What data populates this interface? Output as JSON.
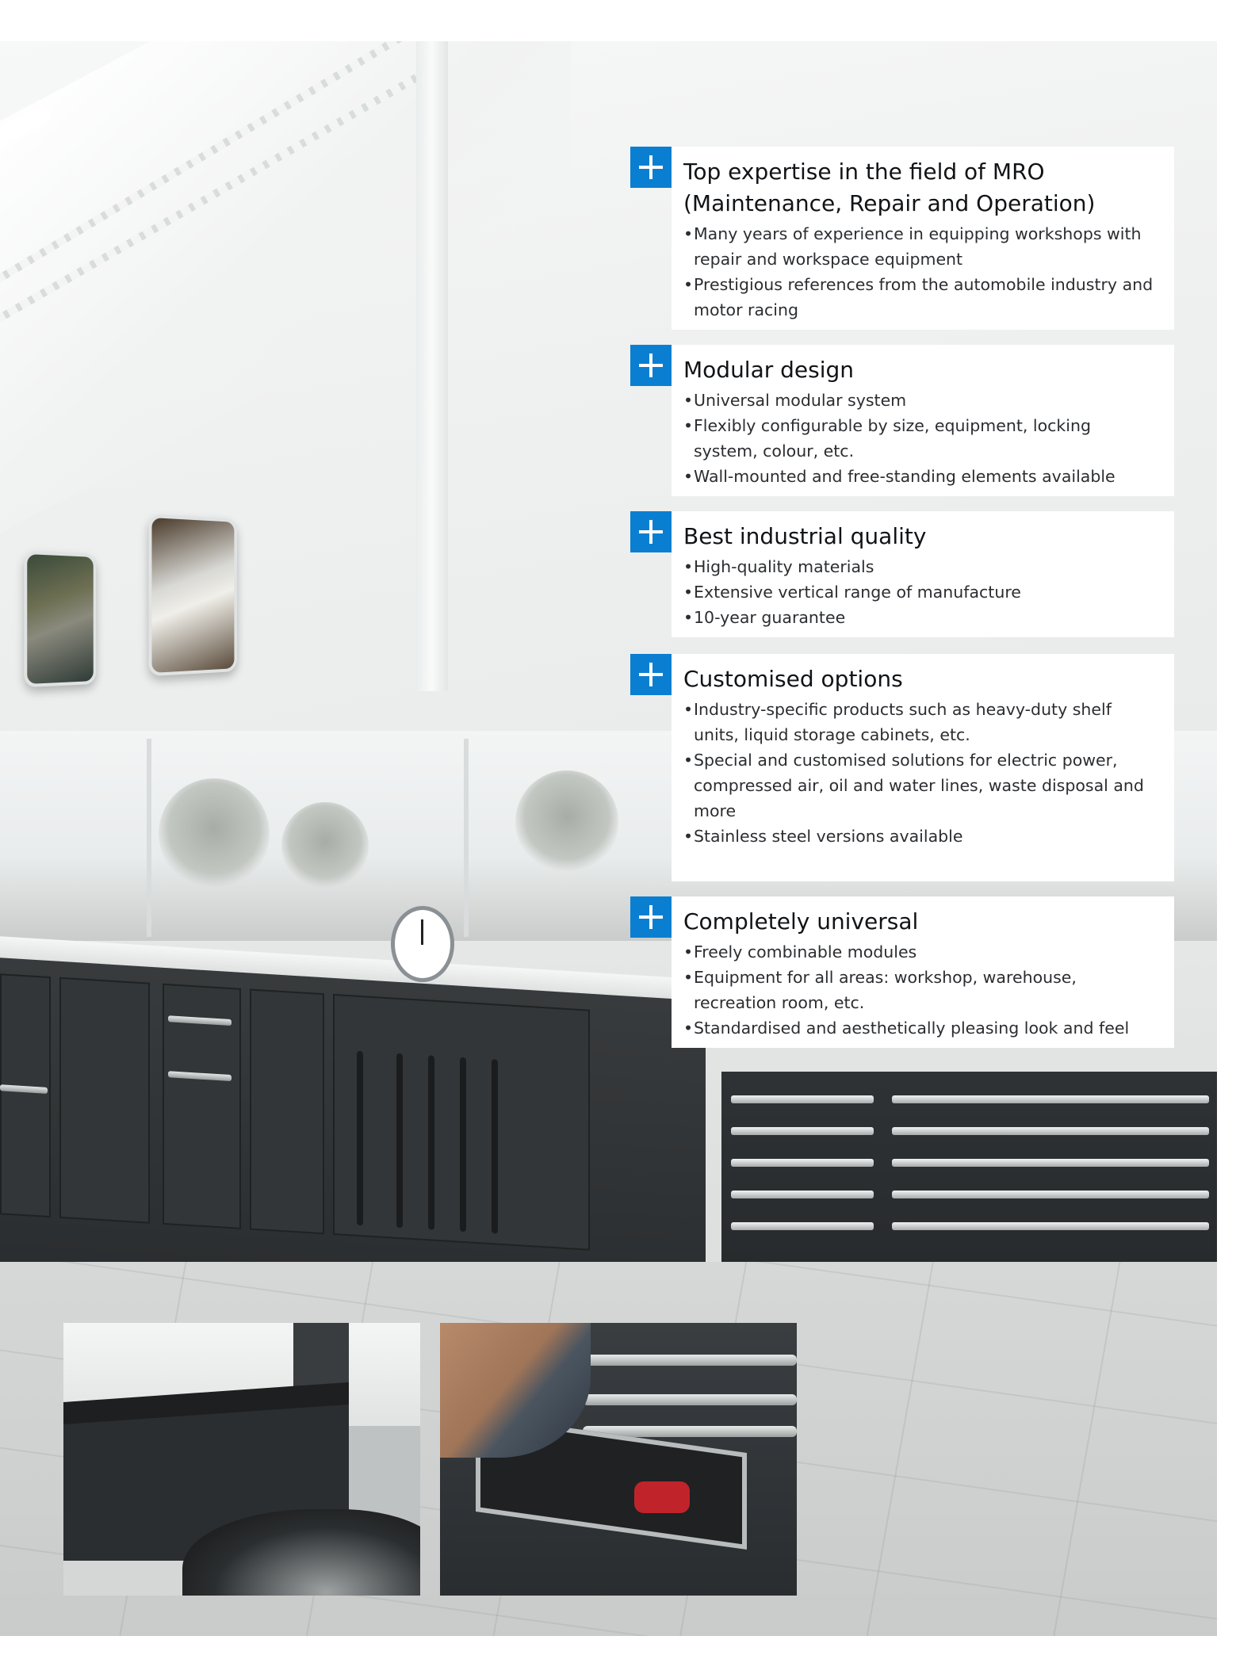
{
  "colors": {
    "accent": "#0a7fd1",
    "panel_background": "#ffffff",
    "title_text": "#111316",
    "body_text": "#2b2d30"
  },
  "icons": [
    "plus-icon"
  ],
  "panels": [
    {
      "title": "Top expertise in the field of MRO (Maintenance, Repair and Operation)",
      "items": [
        "Many years of experience in equipping workshops with repair and workspace equipment",
        "Prestigious references from the automobile industry and motor racing"
      ]
    },
    {
      "title": "Modular design",
      "items": [
        "Universal modular system",
        "Flexibly configurable by size, equipment, locking system, colour, etc.",
        "Wall-mounted and free-standing elements available"
      ]
    },
    {
      "title": "Best industrial quality",
      "items": [
        "High-quality materials",
        "Extensive vertical range of manufacture",
        "10-year guarantee"
      ]
    },
    {
      "title": "Customised options",
      "items": [
        "Industry-specific products such as heavy-duty shelf units, liquid storage cabinets, etc.",
        "Special and customised solutions for electric power, compressed air, oil and water lines, waste disposal and more",
        "Stainless steel versions available"
      ]
    },
    {
      "title": "Completely universal",
      "items": [
        "Freely combinable modules",
        "Equipment for all areas: workshop, warehouse, recreation room, etc.",
        "Standardised and aesthetically pleasing look and feel"
      ]
    }
  ]
}
